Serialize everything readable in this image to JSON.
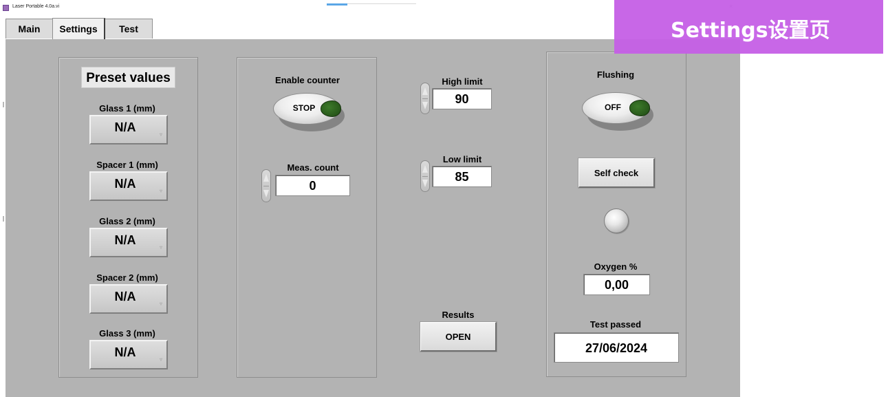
{
  "window": {
    "title": "Laser Portable 4.0a.vi"
  },
  "tabs": [
    {
      "label": "Main"
    },
    {
      "label": "Settings"
    },
    {
      "label": "Test"
    }
  ],
  "preset": {
    "title": "Preset values",
    "items": [
      {
        "label": "Glass 1 (mm)",
        "value": "N/A"
      },
      {
        "label": "Spacer 1 (mm)",
        "value": "N/A"
      },
      {
        "label": "Glass 2 (mm)",
        "value": "N/A"
      },
      {
        "label": "Spacer 2 (mm)",
        "value": "N/A"
      },
      {
        "label": "Glass 3 (mm)",
        "value": "N/A"
      }
    ]
  },
  "counter": {
    "enable_label": "Enable counter",
    "toggle_text": "STOP",
    "meas_label": "Meas. count",
    "meas_value": "0"
  },
  "limits": {
    "high_label": "High limit",
    "high_value": "90",
    "low_label": "Low limit",
    "low_value": "85"
  },
  "results": {
    "label": "Results",
    "button": "OPEN"
  },
  "right": {
    "flushing_label": "Flushing",
    "flushing_toggle": "OFF",
    "self_check": "Self check",
    "oxygen_label": "Oxygen %",
    "oxygen_value": "0,00",
    "test_passed_label": "Test passed",
    "test_passed_value": "27/06/2024"
  },
  "banner": {
    "text": "Settings设置页"
  },
  "colors": {
    "panel": "#b3b3b3",
    "banner": "#c55fe6",
    "lamp_green": "#2e5e1f"
  }
}
